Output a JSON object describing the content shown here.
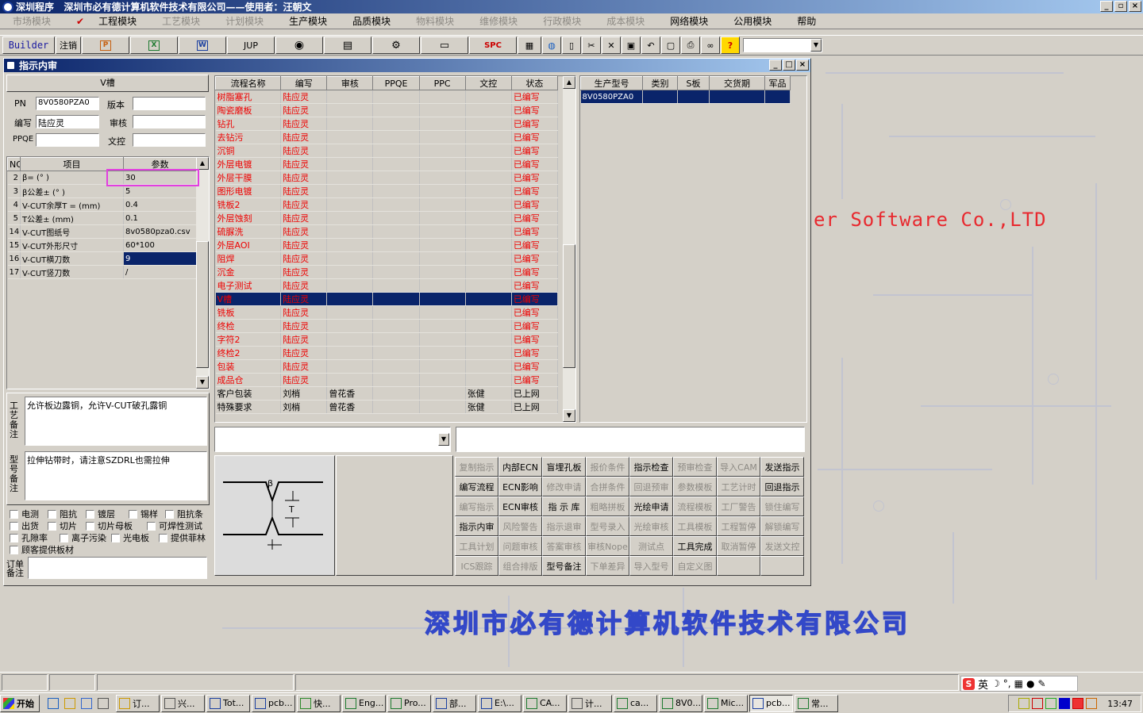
{
  "window": {
    "title": "深圳程序   深圳市必有德计算机软件技术有限公司——使用者：汪朝文"
  },
  "menu": [
    {
      "label": "市场模块",
      "enabled": false
    },
    {
      "label": "工程模块",
      "enabled": true,
      "checked": true
    },
    {
      "label": "工艺模块",
      "enabled": false
    },
    {
      "label": "计划模块",
      "enabled": false
    },
    {
      "label": "生产模块",
      "enabled": true
    },
    {
      "label": "品质模块",
      "enabled": true
    },
    {
      "label": "物料模块",
      "enabled": false
    },
    {
      "label": "维修模块",
      "enabled": false
    },
    {
      "label": "行政模块",
      "enabled": false
    },
    {
      "label": "成本模块",
      "enabled": false
    },
    {
      "label": "网络模块",
      "enabled": true
    },
    {
      "label": "公用模块",
      "enabled": true
    },
    {
      "label": "帮助",
      "enabled": true
    }
  ],
  "toolbar": {
    "builder": "Builder",
    "logout": "注销",
    "jup": "JUP",
    "spc": "SPC"
  },
  "desktop": {
    "watermark": "er Software Co.,LTD",
    "company": "深圳市必有德计算机软件技术有限公司"
  },
  "child": {
    "title": "指示内审",
    "section_title": "V槽",
    "pn_label": "PN",
    "pn_value": "8V0580PZA0",
    "version_label": "版本",
    "version_value": "",
    "editor_label": "编写",
    "editor_value": "陆应灵",
    "review_label": "审核",
    "review_value": "",
    "ppqe_label": "PPQE",
    "ppqe_value": "",
    "doc_label": "文控",
    "doc_value": ""
  },
  "params": {
    "headers": [
      "NO",
      "项目",
      "参数"
    ],
    "rows": [
      [
        "2",
        "β=  (° )",
        "30"
      ],
      [
        "3",
        "β公差±  (° )",
        "5"
      ],
      [
        "4",
        "V-CUT余厚T =  (mm)",
        "0.4"
      ],
      [
        "5",
        "T公差±  (mm)",
        "0.1"
      ],
      [
        "14",
        "V-CUT图纸号",
        "8v0580pza0.csv"
      ],
      [
        "15",
        "V-CUT外形尺寸",
        "60*100"
      ],
      [
        "16",
        "V-CUT横刀数",
        "9"
      ],
      [
        "17",
        "V-CUT竖刀数",
        "/"
      ]
    ]
  },
  "remarks": {
    "process_label": "工艺备注",
    "process_text": "允许板边露铜，允许V-CUT破孔露铜",
    "model_label": "型号备注",
    "model_text": "拉伸钻带时，请注意SZDRL也需拉伸",
    "order_label": "订单备注"
  },
  "checkboxes": [
    [
      "电测",
      "阻抗",
      "镀层",
      "锡样",
      "阻抗条"
    ],
    [
      "出货",
      "切片",
      "切片母板",
      "可焊性测试"
    ],
    [
      "孔隙率",
      "离子污染",
      "光电板",
      "提供菲林"
    ],
    [
      "顾客提供板材"
    ]
  ],
  "flow": {
    "headers": [
      "流程名称",
      "编写",
      "审核",
      "PPQE",
      "PPC",
      "文控",
      "状态"
    ],
    "rows": [
      [
        "树脂塞孔",
        "陆应灵",
        "",
        "",
        "",
        "",
        "已编写"
      ],
      [
        "陶瓷磨板",
        "陆应灵",
        "",
        "",
        "",
        "",
        "已编写"
      ],
      [
        "钻孔",
        "陆应灵",
        "",
        "",
        "",
        "",
        "已编写"
      ],
      [
        "去钻污",
        "陆应灵",
        "",
        "",
        "",
        "",
        "已编写"
      ],
      [
        "沉铜",
        "陆应灵",
        "",
        "",
        "",
        "",
        "已编写"
      ],
      [
        "外层电镀",
        "陆应灵",
        "",
        "",
        "",
        "",
        "已编写"
      ],
      [
        "外层干膜",
        "陆应灵",
        "",
        "",
        "",
        "",
        "已编写"
      ],
      [
        "图形电镀",
        "陆应灵",
        "",
        "",
        "",
        "",
        "已编写"
      ],
      [
        "铣板2",
        "陆应灵",
        "",
        "",
        "",
        "",
        "已编写"
      ],
      [
        "外层蚀刻",
        "陆应灵",
        "",
        "",
        "",
        "",
        "已编写"
      ],
      [
        "硫脲洗",
        "陆应灵",
        "",
        "",
        "",
        "",
        "已编写"
      ],
      [
        "外层AOI",
        "陆应灵",
        "",
        "",
        "",
        "",
        "已编写"
      ],
      [
        "阻焊",
        "陆应灵",
        "",
        "",
        "",
        "",
        "已编写"
      ],
      [
        "沉金",
        "陆应灵",
        "",
        "",
        "",
        "",
        "已编写"
      ],
      [
        "电子测试",
        "陆应灵",
        "",
        "",
        "",
        "",
        "已编写"
      ],
      [
        "V槽",
        "陆应灵",
        "",
        "",
        "",
        "",
        "已编写"
      ],
      [
        "铣板",
        "陆应灵",
        "",
        "",
        "",
        "",
        "已编写"
      ],
      [
        "终检",
        "陆应灵",
        "",
        "",
        "",
        "",
        "已编写"
      ],
      [
        "字符2",
        "陆应灵",
        "",
        "",
        "",
        "",
        "已编写"
      ],
      [
        "终检2",
        "陆应灵",
        "",
        "",
        "",
        "",
        "已编写"
      ],
      [
        "包装",
        "陆应灵",
        "",
        "",
        "",
        "",
        "已编写"
      ],
      [
        "成品仓",
        "陆应灵",
        "",
        "",
        "",
        "",
        "已编写"
      ],
      [
        "客户包装",
        "刘梢",
        "曾花香",
        "",
        "",
        "张健",
        "已上网"
      ],
      [
        "特殊要求",
        "刘梢",
        "曾花香",
        "",
        "",
        "张健",
        "已上网"
      ]
    ]
  },
  "models": {
    "headers": [
      "生产型号",
      "类别",
      "S板",
      "交货期",
      "军品"
    ],
    "rows": [
      [
        "8V0580PZA0",
        "",
        "",
        "",
        ""
      ]
    ]
  },
  "diagram": {
    "beta": "β",
    "t": "T"
  },
  "buttons": [
    {
      "label": "复制指示",
      "enabled": false
    },
    {
      "label": "内部ECN",
      "enabled": true
    },
    {
      "label": "盲埋孔板",
      "enabled": true
    },
    {
      "label": "报价条件",
      "enabled": false
    },
    {
      "label": "指示检查",
      "enabled": true
    },
    {
      "label": "预审检查",
      "enabled": false
    },
    {
      "label": "导入CAM",
      "enabled": false
    },
    {
      "label": "发送指示",
      "enabled": true
    },
    {
      "label": "编写流程",
      "enabled": true
    },
    {
      "label": "ECN影响",
      "enabled": true
    },
    {
      "label": "修改申请",
      "enabled": false
    },
    {
      "label": "合拼条件",
      "enabled": false
    },
    {
      "label": "回退预审",
      "enabled": false
    },
    {
      "label": "参数模板",
      "enabled": false
    },
    {
      "label": "工艺计时",
      "enabled": false
    },
    {
      "label": "回退指示",
      "enabled": true
    },
    {
      "label": "编写指示",
      "enabled": false
    },
    {
      "label": "ECN审核",
      "enabled": true
    },
    {
      "label": "指 示 库",
      "enabled": true
    },
    {
      "label": "粗略拼板",
      "enabled": false
    },
    {
      "label": "光绘申请",
      "enabled": true
    },
    {
      "label": "流程模板",
      "enabled": false
    },
    {
      "label": "工厂警告",
      "enabled": false
    },
    {
      "label": "锁住编写",
      "enabled": false
    },
    {
      "label": "指示内审",
      "enabled": true
    },
    {
      "label": "风险警告",
      "enabled": false
    },
    {
      "label": "指示退审",
      "enabled": false
    },
    {
      "label": "型号录入",
      "enabled": false
    },
    {
      "label": "光绘审核",
      "enabled": false
    },
    {
      "label": "工具模板",
      "enabled": false
    },
    {
      "label": "工程暂停",
      "enabled": false
    },
    {
      "label": "解锁编写",
      "enabled": false
    },
    {
      "label": "工具计划",
      "enabled": false
    },
    {
      "label": "问题审核",
      "enabled": false
    },
    {
      "label": "答案审核",
      "enabled": false
    },
    {
      "label": "审核Nope",
      "enabled": false
    },
    {
      "label": "测试点",
      "enabled": false
    },
    {
      "label": "工具完成",
      "enabled": true
    },
    {
      "label": "取消暂停",
      "enabled": false
    },
    {
      "label": "发送文控",
      "enabled": false
    },
    {
      "label": "ICS跟踪",
      "enabled": false
    },
    {
      "label": "组合排版",
      "enabled": false
    },
    {
      "label": "型号备注",
      "enabled": true
    },
    {
      "label": "下单差异",
      "enabled": false
    },
    {
      "label": "导入型号",
      "enabled": false
    },
    {
      "label": "自定义图",
      "enabled": false
    },
    {
      "label": "",
      "enabled": false
    },
    {
      "label": "",
      "enabled": false
    }
  ],
  "taskbar": {
    "start": "开始",
    "tasks": [
      "订...",
      "兴...",
      "Tot...",
      "pcb...",
      "快...",
      "Eng...",
      "Pro...",
      "部...",
      "E:\\...",
      "CA...",
      "计...",
      "ca...",
      "8V0...",
      "Mic...",
      "pcb...",
      "常..."
    ],
    "active_index": 14,
    "clock": "13:47"
  },
  "ime": {
    "lang": "英"
  }
}
